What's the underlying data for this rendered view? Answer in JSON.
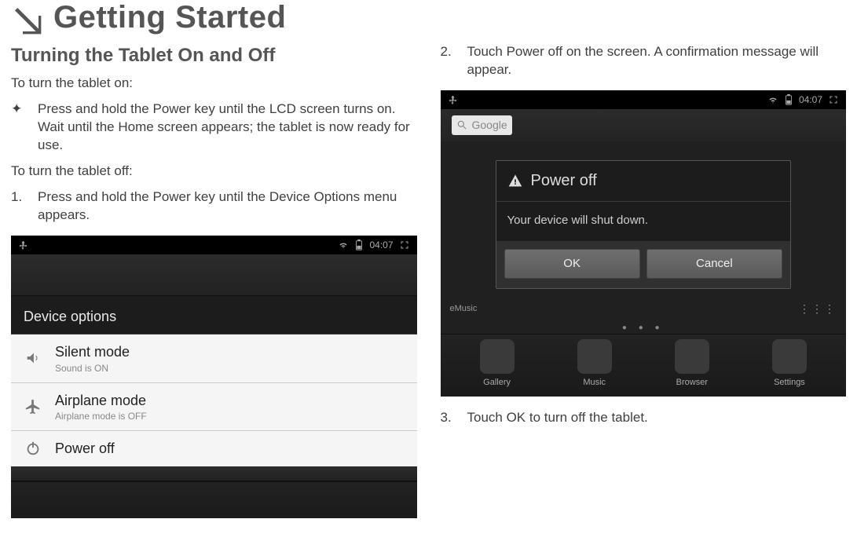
{
  "header": {
    "title": "Getting Started"
  },
  "left": {
    "h2": "Turning the Tablet On and Off",
    "intro_on": "To turn the tablet on:",
    "star_item": "Press and hold the Power key until the LCD screen turns on. Wait until the Home screen appears; the tablet is now ready for use.",
    "intro_off": "To turn the tablet off:",
    "step1": "Press and hold the Power key until the Device Options menu appears.",
    "shot": {
      "time": "04:07",
      "panel_title": "Device options",
      "options": [
        {
          "main": "Silent mode",
          "sub": "Sound is ON",
          "icon": "volume-icon"
        },
        {
          "main": "Airplane mode",
          "sub": "Airplane mode is OFF",
          "icon": "airplane-icon"
        },
        {
          "main": "Power off",
          "sub": "",
          "icon": "power-icon"
        }
      ]
    }
  },
  "right": {
    "step2": "Touch Power off on the screen. A confirmation message will appear.",
    "step3": "Touch OK to turn off the tablet.",
    "shot": {
      "time": "04:07",
      "search_placeholder": "Google",
      "dialog": {
        "title": "Power off",
        "body": "Your device will shut down.",
        "ok": "OK",
        "cancel": "Cancel"
      },
      "dock": [
        "Gallery",
        "Music",
        "Browser",
        "Settings"
      ],
      "emusic_label": "eMusic"
    }
  }
}
